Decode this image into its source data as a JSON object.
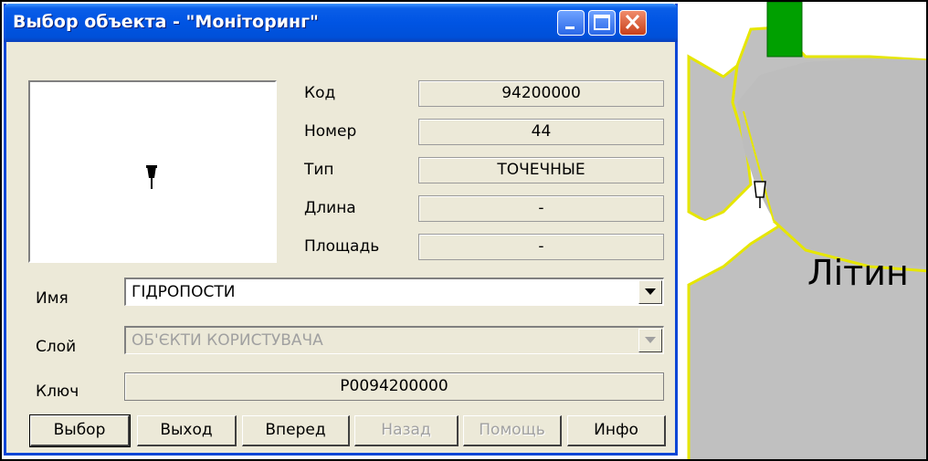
{
  "window": {
    "title": "Выбор объекта - \"Моніторинг\"",
    "controls": [
      "minimize-icon",
      "maximize-icon",
      "close-icon"
    ]
  },
  "properties": [
    {
      "label": "Код",
      "value": "94200000"
    },
    {
      "label": "Номер",
      "value": "44"
    },
    {
      "label": "Тип",
      "value": "ТОЧЕЧНЫЕ"
    },
    {
      "label": "Длина",
      "value": "-"
    },
    {
      "label": "Площадь",
      "value": "-"
    }
  ],
  "fields": {
    "name_label": "Имя",
    "name_value": "ГІДРОПОСТИ",
    "layer_label": "Слой",
    "layer_value": "ОБ'ЄКТИ КОРИСТУВАЧА",
    "key_label": "Ключ",
    "key_value": "P0094200000"
  },
  "buttons": [
    {
      "label": "Выбор",
      "enabled": true,
      "default": true
    },
    {
      "label": "Выход",
      "enabled": true
    },
    {
      "label": "Вперед",
      "enabled": true
    },
    {
      "label": "Назад",
      "enabled": false
    },
    {
      "label": "Помощь",
      "enabled": false
    },
    {
      "label": "Инфо",
      "enabled": true
    }
  ],
  "map": {
    "label": "Літин",
    "colors": {
      "region": "#c0c0c0",
      "border": "#e8e800",
      "green_area": "#00a000"
    }
  },
  "colors": {
    "titlebar": "#0054e3",
    "dialog_bg": "#ece9d8",
    "close_button": "#d9532d"
  }
}
